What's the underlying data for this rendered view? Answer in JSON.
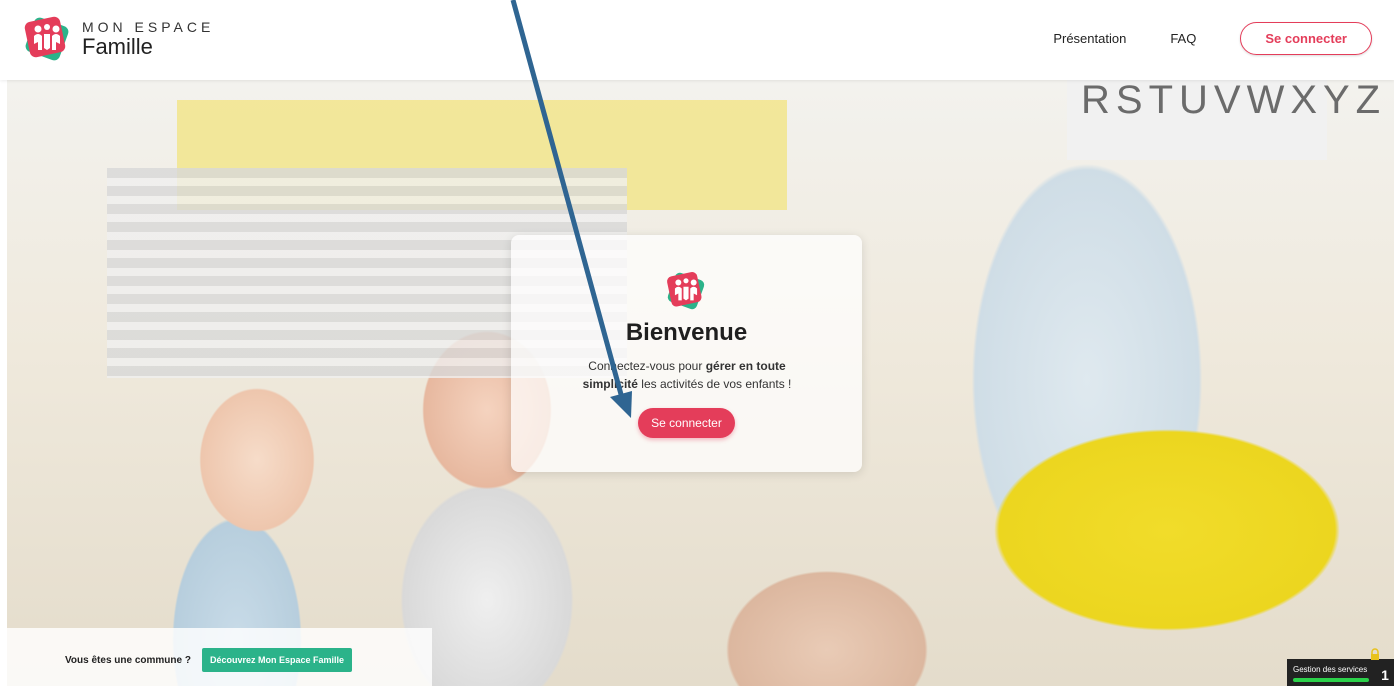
{
  "header": {
    "logo_top": "MON ESPACE",
    "logo_bottom": "Famille",
    "nav": {
      "presentation": "Présentation",
      "faq": "FAQ",
      "login": "Se connecter"
    }
  },
  "hero": {
    "alphabet": "RSTUVWXYZ",
    "card": {
      "title": "Bienvenue",
      "text_before": "Connectez-vous pour ",
      "text_bold": "gérer en toute simplicité",
      "text_after": " les activités de vos enfants !",
      "button": "Se connecter"
    }
  },
  "footer": {
    "commune_question": "Vous êtes une commune ?",
    "discover_button": "Découvrez Mon Espace Famille"
  },
  "services_widget": {
    "label": "Gestion des services",
    "count": "1"
  },
  "colors": {
    "accent": "#e43d5a",
    "green": "#2bb38a",
    "arrow": "#2f6592"
  }
}
